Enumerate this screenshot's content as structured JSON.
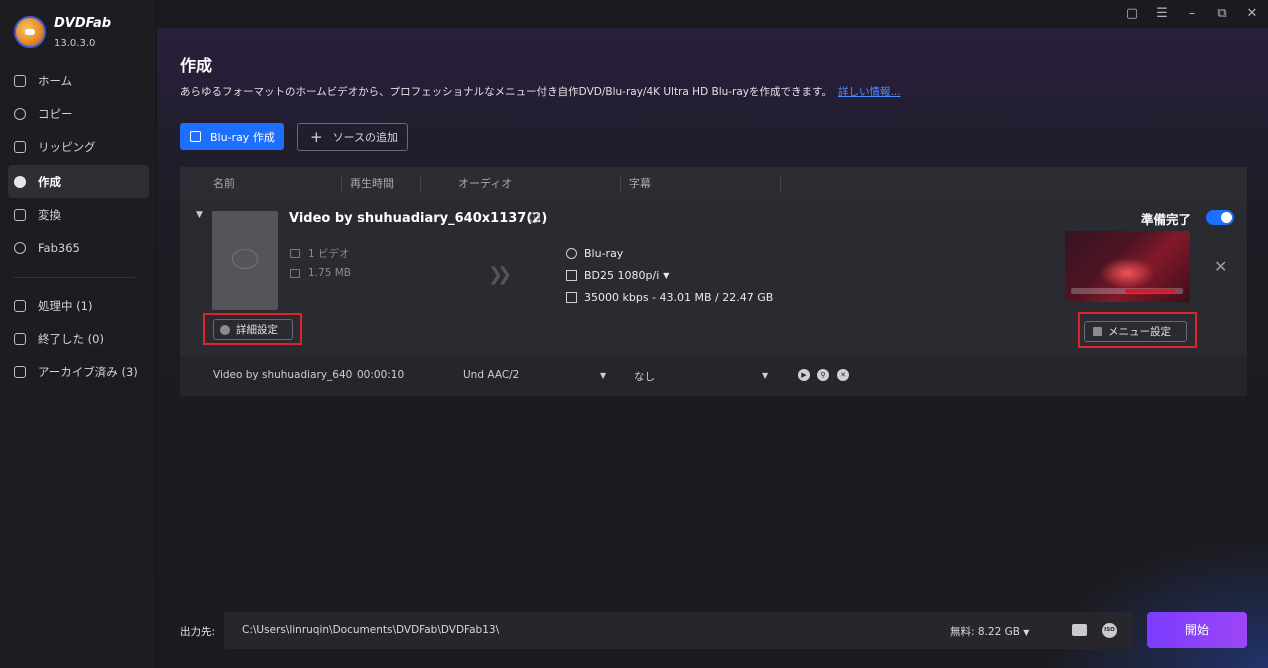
{
  "app": {
    "name": "DVDFab",
    "version": "13.0.3.0"
  },
  "window_controls": [
    "shirt-icon",
    "menu-icon",
    "minimize-icon",
    "restore-icon",
    "close-icon"
  ],
  "sidebar": {
    "items": [
      {
        "label": "ホーム",
        "icon": "home-icon"
      },
      {
        "label": "コピー",
        "icon": "copy-icon"
      },
      {
        "label": "リッピング",
        "icon": "ripper-icon"
      },
      {
        "label": "作成",
        "icon": "creator-icon",
        "active": true
      },
      {
        "label": "変換",
        "icon": "convert-icon"
      },
      {
        "label": "Fab365",
        "icon": "fab365-icon"
      }
    ],
    "task_items": [
      {
        "label": "処理中 (1)",
        "icon": "processing-icon"
      },
      {
        "label": "終了した (0)",
        "icon": "finished-icon"
      },
      {
        "label": "アーカイブ済み (3)",
        "icon": "archive-icon"
      }
    ]
  },
  "header": {
    "title": "作成",
    "description": "あらゆるフォーマットのホームビデオから、プロフェッショナルなメニュー付き自作DVD/Blu-ray/4K Ultra HD Blu-rayを作成できます。",
    "more_link": "詳しい情報..."
  },
  "toolbar": {
    "create_label": "Blu-ray 作成",
    "add_source_label": "ソースの追加"
  },
  "table": {
    "columns": [
      "名前",
      "再生時間",
      "オーディオ",
      "字幕"
    ],
    "item": {
      "title": "Video by shuhuadiary_640x1137(2)",
      "video_count": "1 ビデオ",
      "size": "1.75 MB",
      "output_format": "Blu-ray",
      "quality": "BD25 1080p/i",
      "bitrate": "35000 kbps - 43.01 MB / 22.47 GB",
      "status": "準備完了",
      "ready_enabled": true,
      "detail_button": "詳細設定",
      "menu_button": "メニュー設定"
    },
    "track": {
      "name": "Video by shuhuadiary_640",
      "duration": "00:00:10",
      "audio": "Und  AAC/2",
      "subtitle": "なし"
    }
  },
  "footer": {
    "output_label": "出力先:",
    "path": "C:\\Users\\linruqin\\Documents\\DVDFab\\DVDFab13\\",
    "free_space": "無料:   8.22 GB",
    "iso_label": "ISO",
    "start_label": "開始"
  },
  "colors": {
    "accent": "#1f6fff",
    "start": "#8a42f8",
    "highlight": "#e0222b"
  }
}
